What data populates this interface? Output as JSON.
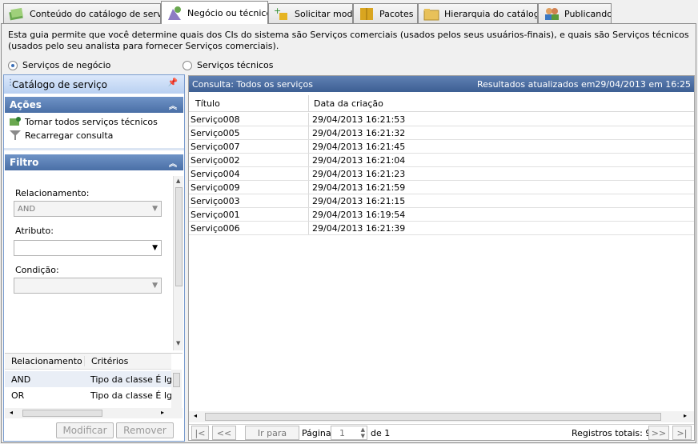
{
  "tabs": [
    {
      "label": "Conteúdo do catálogo de serviço",
      "icon": "catalog-content-icon"
    },
    {
      "label": "Negócio ou técnico",
      "icon": "business-technical-icon",
      "active": true
    },
    {
      "label": "Solicitar modo",
      "icon": "request-mode-icon"
    },
    {
      "label": "Pacotes",
      "icon": "packages-icon"
    },
    {
      "label": "Hierarquia do catálogo",
      "icon": "folder-icon"
    },
    {
      "label": "Publicando",
      "icon": "publishing-users-icon"
    }
  ],
  "description": "Esta guia permite que você determine quais dos CIs do sistema são Serviços comerciais (usados pelos seus usuários-finais), e quais são Serviços técnicos (usados pelo seu analista para fornecer Serviços comerciais).",
  "radios": {
    "business": "Serviços de negócio",
    "technical": "Serviços técnicos",
    "selected": "business"
  },
  "sidebar": {
    "title": "Catálogo de serviço",
    "actions_header": "Ações",
    "actions": [
      "Tornar todos serviços técnicos",
      "Recarregar consulta"
    ],
    "filter_header": "Filtro",
    "relationship_label": "Relacionamento:",
    "relationship_value": "AND",
    "attribute_label": "Atributo:",
    "attribute_value": "",
    "condition_label": "Condição:",
    "condition_value": "",
    "criteria_headers": [
      "Relacionamento",
      "Critérios"
    ],
    "criteria_rows": [
      [
        "AND",
        "Tipo da classe É Ig"
      ],
      [
        "OR",
        "Tipo da classe É Ig"
      ]
    ],
    "modify_button": "Modificar",
    "remove_button": "Remover"
  },
  "grid": {
    "query_title": "Consulta: Todos os serviços",
    "updated": "Resultados atualizados em29/04/2013 em 16:25",
    "columns": [
      "Título",
      "Data da criação"
    ],
    "rows": [
      [
        "Serviço008",
        "29/04/2013 16:21:53"
      ],
      [
        "Serviço005",
        "29/04/2013 16:21:32"
      ],
      [
        "Serviço007",
        "29/04/2013 16:21:45"
      ],
      [
        "Serviço002",
        "29/04/2013 16:21:04"
      ],
      [
        "Serviço004",
        "29/04/2013 16:21:23"
      ],
      [
        "Serviço009",
        "29/04/2013 16:21:59"
      ],
      [
        "Serviço003",
        "29/04/2013 16:21:15"
      ],
      [
        "Serviço001",
        "29/04/2013 16:19:54"
      ],
      [
        "Serviço006",
        "29/04/2013 16:21:39"
      ]
    ]
  },
  "pager": {
    "first": "|<",
    "prev": "<<",
    "goto": "Ir para",
    "page_label": "Página",
    "page_value": "1",
    "of": "de 1",
    "total": "Registros totais: 9",
    "next": ">>",
    "last": ">|"
  },
  "colors": {
    "accent": "#4a6fa6",
    "header_blue": "#3d5f93"
  }
}
